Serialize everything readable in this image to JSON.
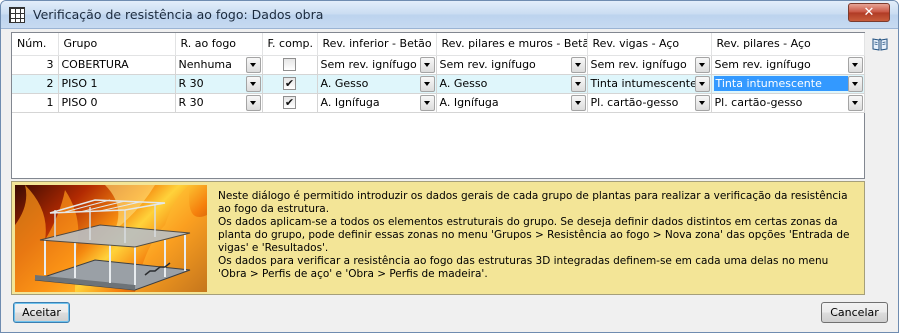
{
  "window": {
    "title": "Verificação de resistência ao fogo: Dados obra",
    "close_label": "✕"
  },
  "grid": {
    "columns": [
      "Núm.",
      "Grupo",
      "R. ao fogo",
      "F. comp.",
      "Rev. inferior - Betão",
      "Rev. pilares e muros - Betão",
      "Rev. vigas - Aço",
      "Rev. pilares - Aço"
    ],
    "rows": [
      {
        "num": "3",
        "grupo": "COBERTURA",
        "r_fogo": "Nenhuma",
        "f_comp": false,
        "rev_inferior": "Sem rev. ignífugo",
        "rev_pilares_muros": "Sem rev. ignífugo",
        "rev_vigas": "Sem rev. ignífugo",
        "rev_pilares_aco": "Sem rev. ignífugo"
      },
      {
        "num": "2",
        "grupo": "PISO 1",
        "r_fogo": "R 30",
        "f_comp": true,
        "rev_inferior": "A. Gesso",
        "rev_pilares_muros": "A. Gesso",
        "rev_vigas": "Tinta intumescente",
        "rev_pilares_aco": "Tinta intumescente"
      },
      {
        "num": "1",
        "grupo": "PISO 0",
        "r_fogo": "R 30",
        "f_comp": true,
        "rev_inferior": "A. Ignífuga",
        "rev_pilares_muros": "A. Ignífuga",
        "rev_vigas": "Pl. cartão-gesso",
        "rev_pilares_aco": "Pl. cartão-gesso"
      }
    ],
    "selected_row": 1
  },
  "info": {
    "paragraphs": [
      "Neste diálogo é permitido introduzir os dados gerais de cada grupo de plantas para realizar a verificação da resistência ao fogo da estrutura.",
      "Os dados aplicam-se a todos os elementos estruturais do grupo. Se deseja definir dados distintos em certas zonas da planta do grupo, pode definir essas zonas no menu 'Grupos > Resistência ao fogo > Nova zona' das opções 'Entrada de vigas' e 'Resultados'.",
      "Os dados para verificar a resistência ao fogo das estruturas 3D integradas definem-se em cada uma delas no menu 'Obra > Perfis de aço' e 'Obra > Perfis de madeira'."
    ]
  },
  "buttons": {
    "accept": "Aceitar",
    "cancel": "Cancelar"
  },
  "icons": {
    "app": "grid-table-icon",
    "help": "book-help-icon",
    "check": "✔"
  },
  "colors": {
    "selected_row": "#dff6fb",
    "info_bg": "#f3e597",
    "highlight": "#3399ff"
  }
}
